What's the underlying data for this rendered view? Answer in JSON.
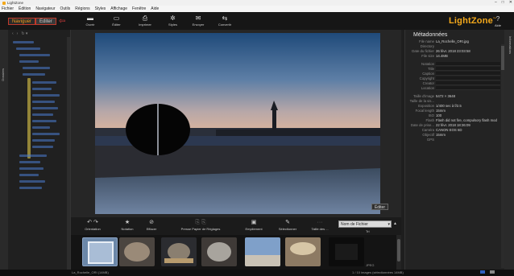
{
  "window": {
    "title": "LightZone",
    "app_icon": "lightzone-app-icon",
    "controls": [
      "–",
      "□",
      "✕"
    ]
  },
  "menu": [
    {
      "label": "Fichier"
    },
    {
      "label": "Édition"
    },
    {
      "label": "Navigateur"
    },
    {
      "label": "Outils"
    },
    {
      "label": "Régions"
    },
    {
      "label": "Styles"
    },
    {
      "label": "Affichage"
    },
    {
      "label": "Fenêtre"
    },
    {
      "label": "Aide"
    }
  ],
  "modes": {
    "navigate": "Naviguer",
    "edit": "Editer"
  },
  "toolbar": [
    {
      "label": "Ouvrir",
      "icon": "open-icon",
      "glyph": "▬"
    },
    {
      "label": "Éditer",
      "icon": "edit-icon",
      "glyph": "▭"
    },
    {
      "label": "Imprimer",
      "icon": "print-icon",
      "glyph": "⎙"
    },
    {
      "label": "Styles",
      "icon": "styles-icon",
      "glyph": "✲"
    },
    {
      "label": "Envoyer",
      "icon": "send-icon",
      "glyph": "✉"
    },
    {
      "label": "Convertir",
      "icon": "convert-icon",
      "glyph": "⇆"
    }
  ],
  "brand": {
    "logo_text": "LightZone",
    "logo_mark": "™",
    "accent": "#f3a81b"
  },
  "help": {
    "label": "Aide",
    "icon": "help-icon",
    "glyph": "?"
  },
  "left_panel": {
    "tab_label": "Dossiers",
    "toolbar_glyphs": [
      "‹",
      "›",
      "↻ ▾"
    ]
  },
  "viewer": {
    "edit_button": "Éditer"
  },
  "browse_bar": {
    "items": [
      {
        "label": "Orientation",
        "icon": "rotate-icon",
        "glyph": "↶ ↷"
      },
      {
        "label": "Notation",
        "icon": "star-icon",
        "glyph": "★"
      },
      {
        "label": "Effacer",
        "icon": "clear-icon",
        "glyph": "⊘"
      },
      {
        "label": "Presse Papier de Réglages",
        "icon": "clipboard-icon",
        "glyph": "⎘ ⎘"
      },
      {
        "label": "Empilement",
        "icon": "stack-icon",
        "glyph": "▣"
      },
      {
        "label": "Sélectionner",
        "icon": "select-icon",
        "glyph": "✎"
      },
      {
        "label": "Taille des ...",
        "icon": "size-icon",
        "glyph": "···"
      }
    ],
    "sort_select": "Nom de Fichier",
    "sort_label": "Tri",
    "sort_glyph": "▲"
  },
  "filmstrip": {
    "label": "JPEG"
  },
  "metadata": {
    "title": "Métadonnées",
    "rows": [
      {
        "k": "File name",
        "v": "La_Rochelle_ORI.jpg",
        "field": false
      },
      {
        "k": "Directory",
        "v": "",
        "field": false
      },
      {
        "k": "Date du fichier",
        "v": "26 févr. 2018 23:03:58",
        "field": false
      },
      {
        "k": "File size",
        "v": "14.4MB",
        "field": false
      },
      {
        "k": "Notation",
        "v": "",
        "field": true
      },
      {
        "k": "Title",
        "v": "",
        "field": true
      },
      {
        "k": "Caption",
        "v": "",
        "field": true
      },
      {
        "k": "Copyright",
        "v": "",
        "field": true
      },
      {
        "k": "Creator",
        "v": "",
        "field": true
      },
      {
        "k": "Location",
        "v": "",
        "field": true
      },
      {
        "k": "Taille d'image",
        "v": "5472 × 3648",
        "field": false
      },
      {
        "k": "Taille de la vis...",
        "v": "",
        "field": false
      },
      {
        "k": "Exposition",
        "v": "1/400 sec à f/2.5",
        "field": false
      },
      {
        "k": "Focal length",
        "v": "15mm",
        "field": false
      },
      {
        "k": "ISO",
        "v": "100",
        "field": false
      },
      {
        "k": "Flash",
        "v": "Flash did not fire, compulsory flash mod",
        "field": false
      },
      {
        "k": "Date de prise...",
        "v": "22 févr. 2018 18:36:09",
        "field": false
      },
      {
        "k": "Caméra",
        "v": "CANON EOS 6D",
        "field": false
      },
      {
        "k": "Objectif",
        "v": "15mm",
        "field": false
      },
      {
        "k": "GPS",
        "v": "",
        "field": false
      }
    ]
  },
  "right_tab": {
    "label": "Informations"
  },
  "status": {
    "filename": "La_Rochelle_ORI (14MB)",
    "count": "1 / 10 images (sélectionnées 14MB)"
  }
}
